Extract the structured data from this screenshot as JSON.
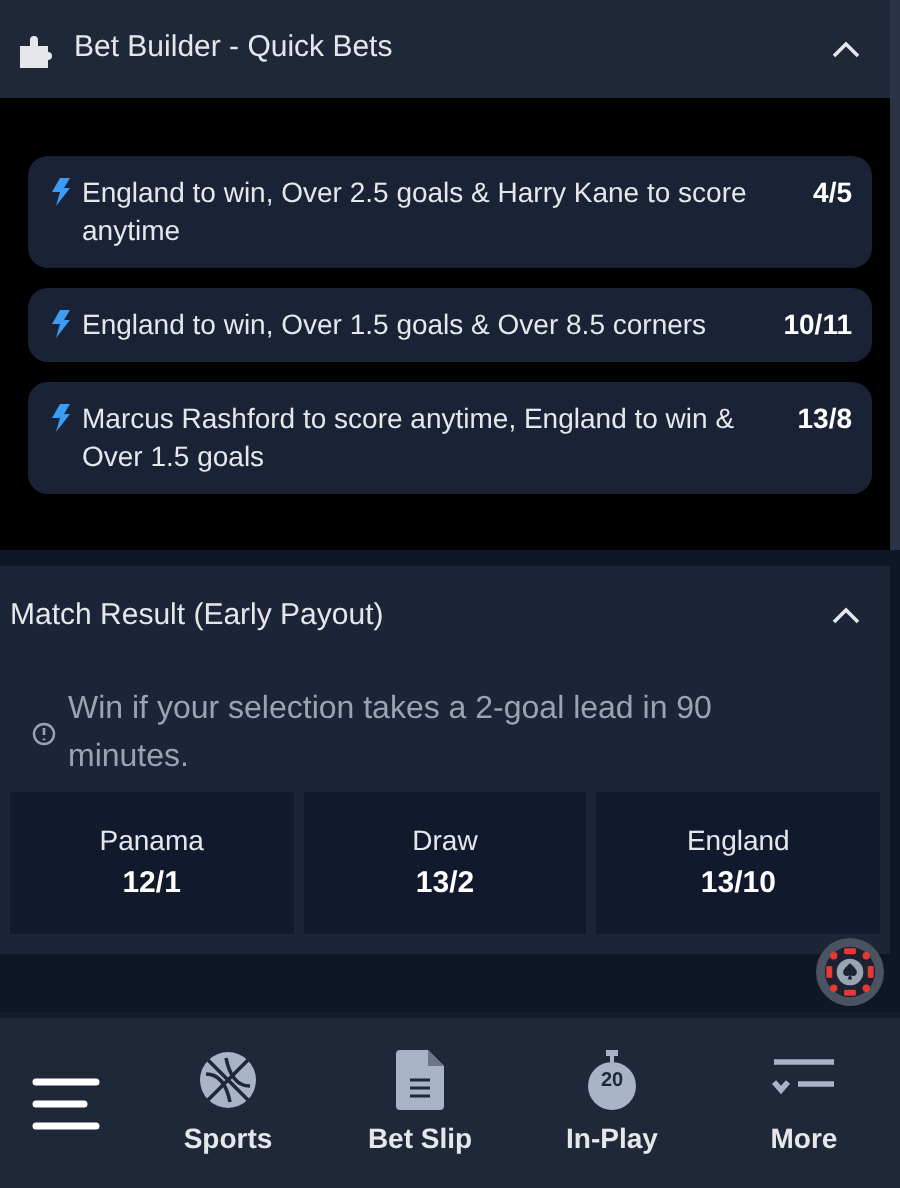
{
  "bet_builder": {
    "title": "Bet Builder - Quick Bets",
    "expanded": true,
    "bets": [
      {
        "text": "England to win, Over 2.5 goals & Harry Kane to score anytime",
        "odds": "4/5"
      },
      {
        "text": "England to win, Over 1.5 goals & Over 8.5 corners",
        "odds": "10/11"
      },
      {
        "text": "Marcus Rashford to score anytime, England to win & Over 1.5 goals",
        "odds": "13/8"
      }
    ]
  },
  "match_result": {
    "title": "Match Result (Early Payout)",
    "expanded": true,
    "info": "Win if your selection takes a 2-goal lead in 90 minutes.",
    "outcomes": [
      {
        "label": "Panama",
        "odds": "12/1"
      },
      {
        "label": "Draw",
        "odds": "13/2"
      },
      {
        "label": "England",
        "odds": "13/10"
      }
    ]
  },
  "bottom_nav": [
    {
      "kind": "menu"
    },
    {
      "kind": "sports",
      "label": "Sports"
    },
    {
      "kind": "betslip",
      "label": "Bet Slip"
    },
    {
      "kind": "inplay",
      "label": "In-Play",
      "badge": "20"
    },
    {
      "kind": "more",
      "label": "More"
    }
  ]
}
